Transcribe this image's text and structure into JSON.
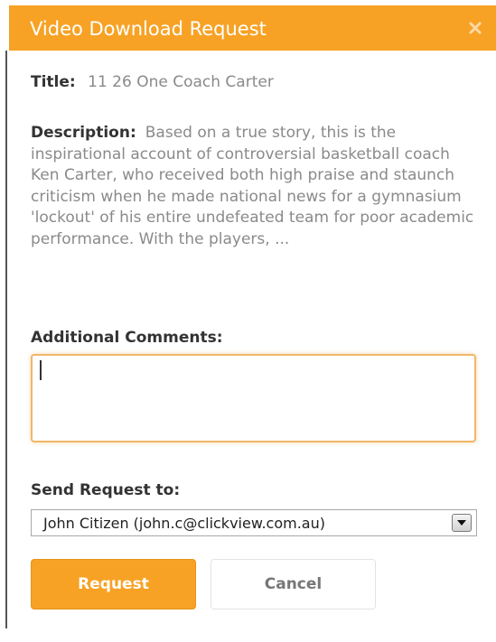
{
  "dialog": {
    "title": "Video Download Request",
    "close_icon": "close-icon"
  },
  "video": {
    "title_label": "Title:",
    "title_value": "11 26 One Coach Carter",
    "description_label": "Description:",
    "description_value": "Based on a true story, this is the inspirational account of controversial basketball coach Ken Carter, who received both high praise and staunch criticism when he made national news for a gymnasium 'lockout' of his entire undefeated team for poor academic performance. With the players, ..."
  },
  "comments": {
    "label": "Additional Comments:",
    "value": ""
  },
  "send_to": {
    "label": "Send Request to:",
    "selected": "John Citizen (john.c@clickview.com.au)",
    "dropdown_icon": "chevron-down-icon"
  },
  "buttons": {
    "request": "Request",
    "cancel": "Cancel"
  },
  "colors": {
    "accent": "#f7a225",
    "header_text": "#ffffff",
    "label_text": "#333333",
    "value_text": "#8a8a8a",
    "input_focus_border": "#f0b76a"
  }
}
